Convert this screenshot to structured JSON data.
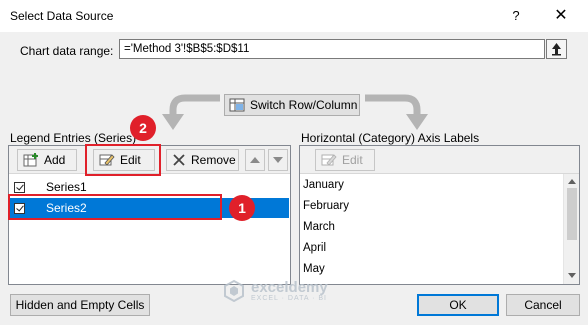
{
  "window": {
    "title": "Select Data Source",
    "help": "?",
    "close": "✕"
  },
  "chart_range": {
    "label": "Chart data range:",
    "value": "='Method 3'!$B$5:$D$11"
  },
  "switch_button": {
    "label": "Switch Row/Column"
  },
  "legend_entries": {
    "title": "Legend Entries (Series)",
    "add_label": "Add",
    "edit_label": "Edit",
    "remove_label": "Remove",
    "items": [
      {
        "label": "Series1",
        "checked": true,
        "selected": false
      },
      {
        "label": "Series2",
        "checked": true,
        "selected": true
      }
    ]
  },
  "axis_labels": {
    "title": "Horizontal (Category) Axis Labels",
    "edit_label": "Edit",
    "items": [
      "January",
      "February",
      "March",
      "April",
      "May"
    ]
  },
  "annotations": {
    "badge_1": "1",
    "badge_2": "2",
    "color": "#e0202a"
  },
  "footer": {
    "hidden_cells_label": "Hidden and Empty Cells",
    "ok_label": "OK",
    "cancel_label": "Cancel"
  },
  "watermark": {
    "name": "exceldemy",
    "tagline": "EXCEL · DATA · BI"
  },
  "colors": {
    "selection": "#0078d7",
    "annotation": "#e0202a"
  }
}
